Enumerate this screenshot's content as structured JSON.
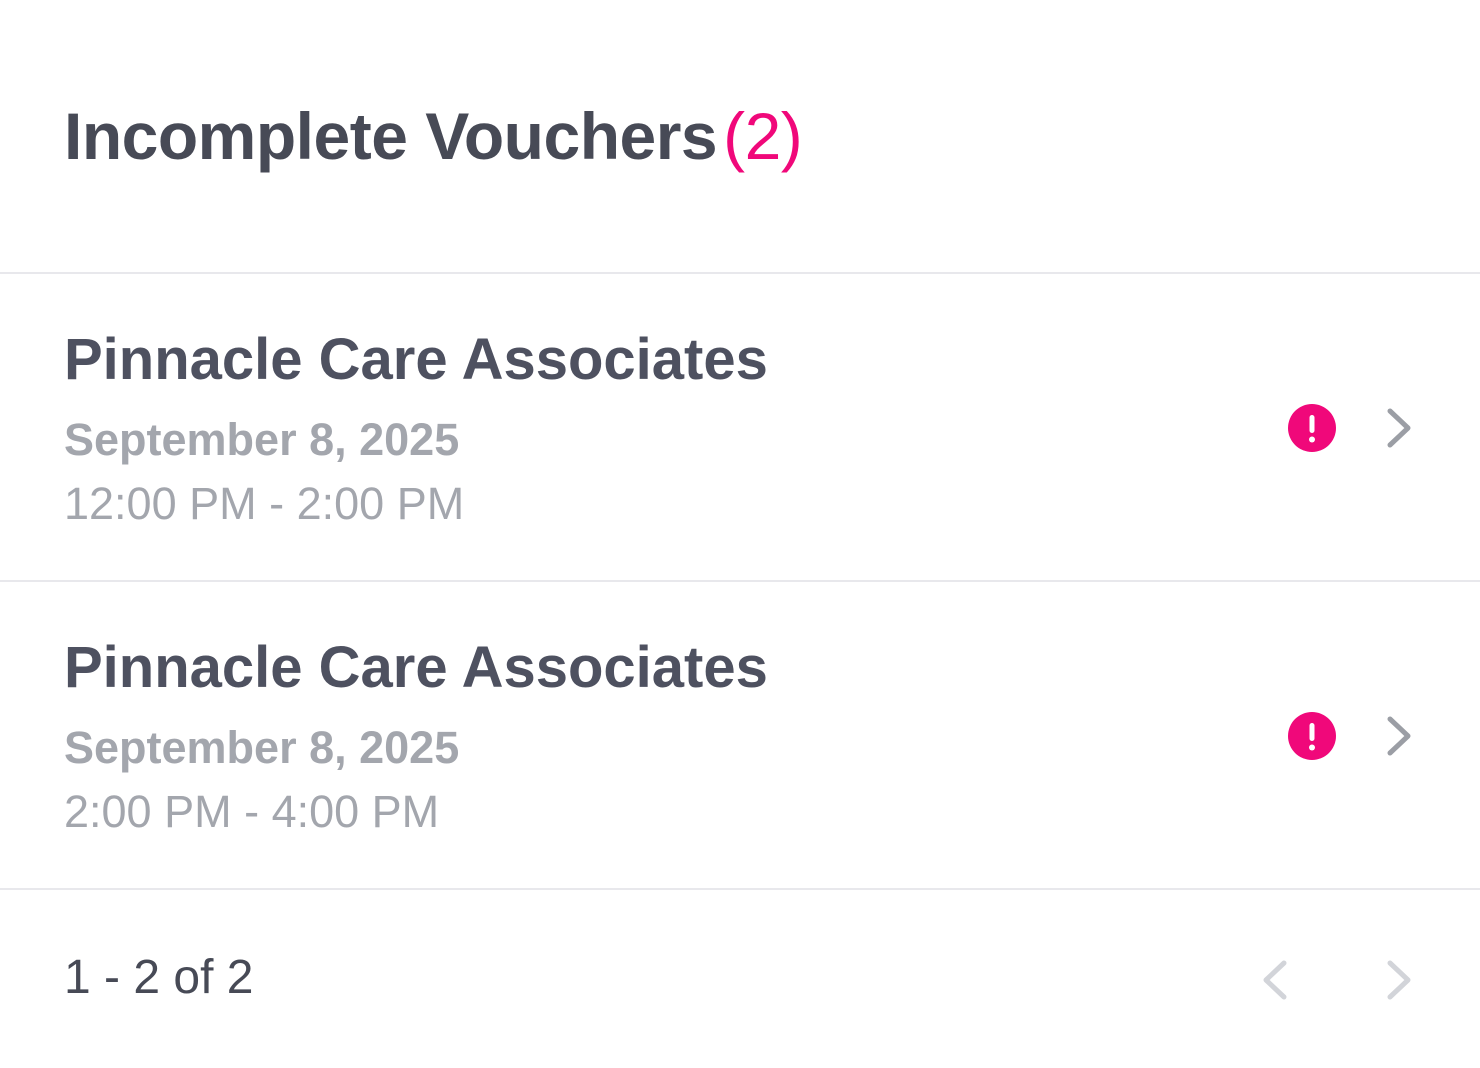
{
  "header": {
    "title": "Incomplete Vouchers",
    "count": "(2)"
  },
  "vouchers": [
    {
      "provider": "Pinnacle Care Associates",
      "date": "September 8, 2025",
      "time": "12:00 PM - 2:00 PM",
      "status_icon": "alert-icon"
    },
    {
      "provider": "Pinnacle Care Associates",
      "date": "September 8, 2025",
      "time": "2:00 PM - 4:00 PM",
      "status_icon": "alert-icon"
    }
  ],
  "pagination": {
    "range": "1 - 2 of 2",
    "prev_icon": "chevron-left-icon",
    "next_icon": "chevron-right-icon"
  },
  "colors": {
    "accent": "#f0087a",
    "heading": "#474a56",
    "muted": "#a3a6ad",
    "chevron": "#9b9ea5",
    "chevron_disabled": "#d2d4d9",
    "divider": "#e8e8ec"
  }
}
